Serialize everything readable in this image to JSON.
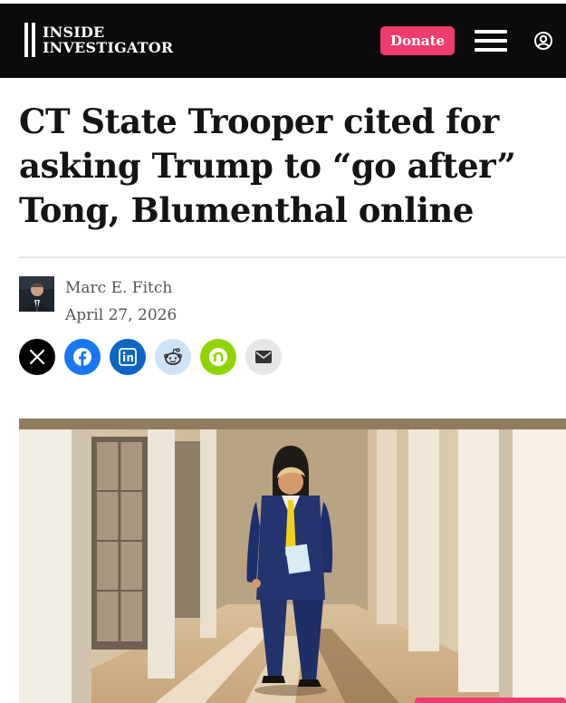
{
  "header": {
    "logo_line1": "INSIDE",
    "logo_line2": "INVESTIGATOR",
    "donate_label": "Donate",
    "menu_icon": "hamburger-menu-icon",
    "account_icon": "user-account-icon",
    "background": "#0b0b0b",
    "accent": "#ef3b6d"
  },
  "article": {
    "headline_line1": "CT State Trooper cited for",
    "headline_line2": "asking Trump to “go after”",
    "headline_line3": "Tong, Blumenthal online",
    "author": "Marc E. Fitch",
    "date": "April 27, 2026"
  },
  "share": {
    "buttons": [
      {
        "icon": "x-icon",
        "color": "#000000"
      },
      {
        "icon": "facebook-icon",
        "color": "#1877f2"
      },
      {
        "icon": "linkedin-icon",
        "color": "#0a66c2"
      },
      {
        "icon": "reddit-icon",
        "color": "#cee3f8"
      },
      {
        "icon": "nextdoor-icon",
        "color": "#8ed500"
      },
      {
        "icon": "email-icon",
        "color": "#e6e6e6"
      }
    ]
  }
}
